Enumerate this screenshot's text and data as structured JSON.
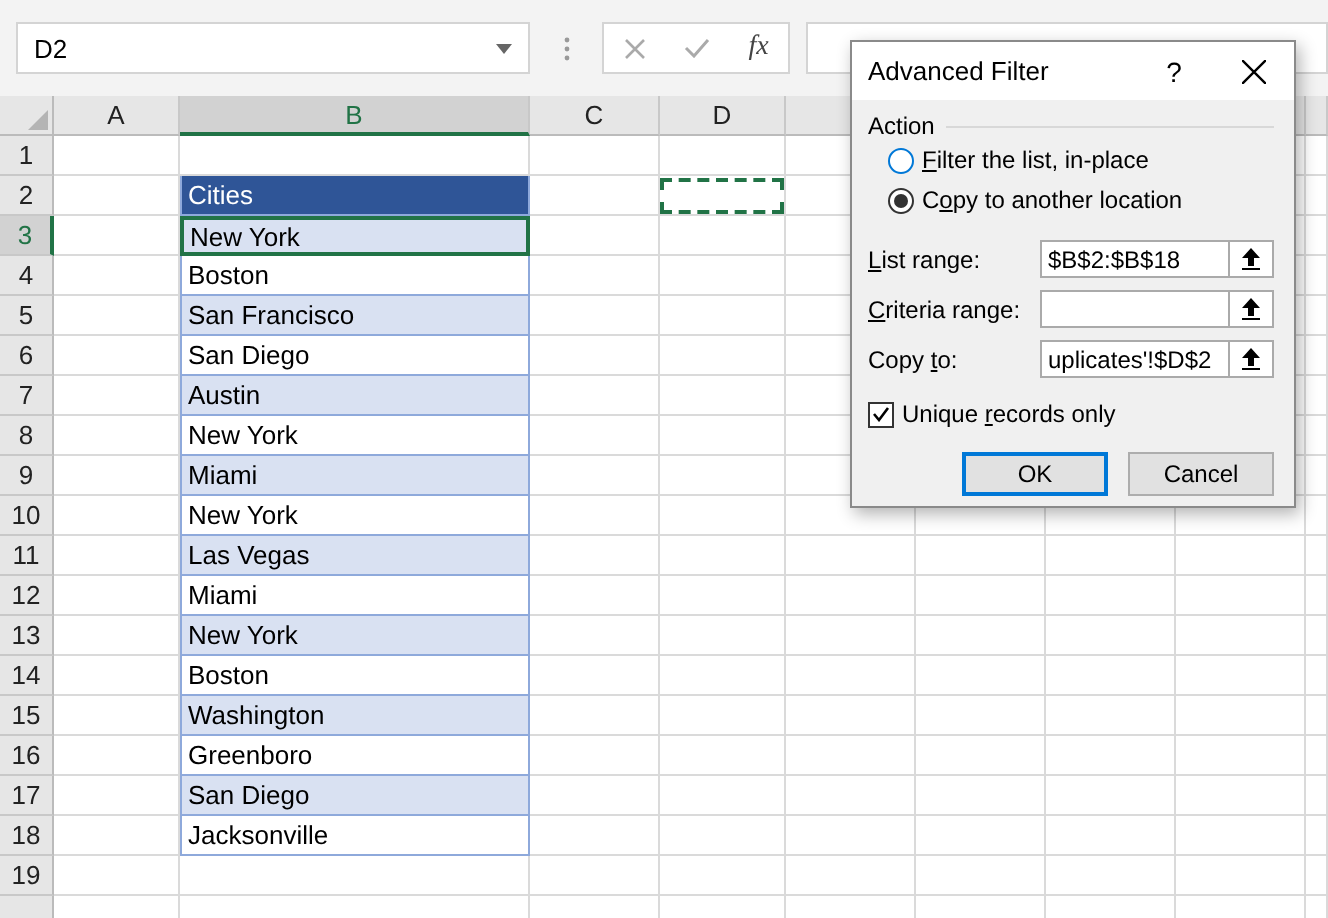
{
  "name_box": {
    "value": "D2"
  },
  "formula_bar": {
    "function_label": "fx"
  },
  "columns": [
    {
      "label": "A",
      "selected": false
    },
    {
      "label": "B",
      "selected": true
    },
    {
      "label": "C",
      "selected": false
    },
    {
      "label": "D",
      "selected": false
    }
  ],
  "rows": [
    {
      "number": "1",
      "selected": false
    },
    {
      "number": "2",
      "selected": false
    },
    {
      "number": "3",
      "selected": true
    },
    {
      "number": "4",
      "selected": false
    },
    {
      "number": "5",
      "selected": false
    },
    {
      "number": "6",
      "selected": false
    },
    {
      "number": "7",
      "selected": false
    },
    {
      "number": "8",
      "selected": false
    },
    {
      "number": "9",
      "selected": false
    },
    {
      "number": "10",
      "selected": false
    },
    {
      "number": "11",
      "selected": false
    },
    {
      "number": "12",
      "selected": false
    },
    {
      "number": "13",
      "selected": false
    },
    {
      "number": "14",
      "selected": false
    },
    {
      "number": "15",
      "selected": false
    },
    {
      "number": "16",
      "selected": false
    },
    {
      "number": "17",
      "selected": false
    },
    {
      "number": "18",
      "selected": false
    },
    {
      "number": "19",
      "selected": false
    }
  ],
  "table": {
    "header": "Cities",
    "items": [
      {
        "text": "New York",
        "selected": true
      },
      {
        "text": "Boston",
        "selected": false
      },
      {
        "text": "San Francisco",
        "selected": false
      },
      {
        "text": "San Diego",
        "selected": false
      },
      {
        "text": "Austin",
        "selected": false
      },
      {
        "text": "New York",
        "selected": false
      },
      {
        "text": "Miami",
        "selected": false
      },
      {
        "text": "New York",
        "selected": false
      },
      {
        "text": "Las Vegas",
        "selected": false
      },
      {
        "text": "Miami",
        "selected": false
      },
      {
        "text": "New York",
        "selected": false
      },
      {
        "text": "Boston",
        "selected": false
      },
      {
        "text": "Washington",
        "selected": false
      },
      {
        "text": "Greenboro",
        "selected": false
      },
      {
        "text": "San Diego",
        "selected": false
      },
      {
        "text": "Jacksonville",
        "selected": false
      }
    ]
  },
  "dialog": {
    "title": "Advanced Filter",
    "help": "?",
    "group": "Action",
    "options": [
      {
        "key": "F",
        "after": "ilter the list, in-place",
        "selected": false
      },
      {
        "before": "C",
        "key": "o",
        "after": "py to another location",
        "selected": true
      }
    ],
    "fields": [
      {
        "key": "L",
        "after": "ist range:",
        "value": "$B$2:$B$18"
      },
      {
        "key": "C",
        "after": "riteria range:"
      },
      {
        "before": "Copy ",
        "key": "t",
        "after": "o:",
        "value": "uplicates'!$D$2"
      }
    ],
    "checkbox": {
      "before": "Unique ",
      "key": "r",
      "after": "ecords only",
      "checked": true
    },
    "buttons": [
      {
        "label": "OK",
        "default": true
      },
      {
        "label": "Cancel",
        "default": false
      }
    ]
  }
}
